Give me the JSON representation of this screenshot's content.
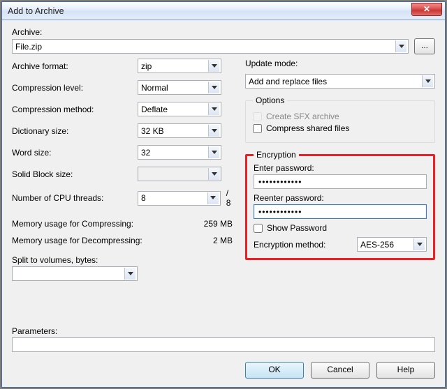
{
  "title": "Add to Archive",
  "archive": {
    "label": "Archive:",
    "value": "File.zip",
    "browse": "..."
  },
  "left": {
    "format": {
      "label": "Archive format:",
      "value": "zip"
    },
    "level": {
      "label": "Compression level:",
      "value": "Normal"
    },
    "method": {
      "label": "Compression method:",
      "value": "Deflate"
    },
    "dict": {
      "label": "Dictionary size:",
      "value": "32 KB"
    },
    "word": {
      "label": "Word size:",
      "value": "32"
    },
    "block": {
      "label": "Solid Block size:",
      "value": ""
    },
    "threads": {
      "label": "Number of CPU threads:",
      "value": "8",
      "of": "/ 8"
    },
    "memc": {
      "label": "Memory usage for Compressing:",
      "value": "259 MB"
    },
    "memd": {
      "label": "Memory usage for Decompressing:",
      "value": "2 MB"
    },
    "split": {
      "label": "Split to volumes, bytes:",
      "value": ""
    }
  },
  "right": {
    "update": {
      "label": "Update mode:",
      "value": "Add and replace files"
    },
    "options": {
      "legend": "Options",
      "sfx": "Create SFX archive",
      "shared": "Compress shared files"
    },
    "enc": {
      "legend": "Encryption",
      "pwd1_label": "Enter password:",
      "pwd1": "••••••••••••",
      "pwd2_label": "Reenter password:",
      "pwd2": "••••••••••••",
      "show": "Show Password",
      "method_label": "Encryption method:",
      "method_value": "AES-256"
    }
  },
  "params": {
    "label": "Parameters:",
    "value": ""
  },
  "buttons": {
    "ok": "OK",
    "cancel": "Cancel",
    "help": "Help"
  }
}
